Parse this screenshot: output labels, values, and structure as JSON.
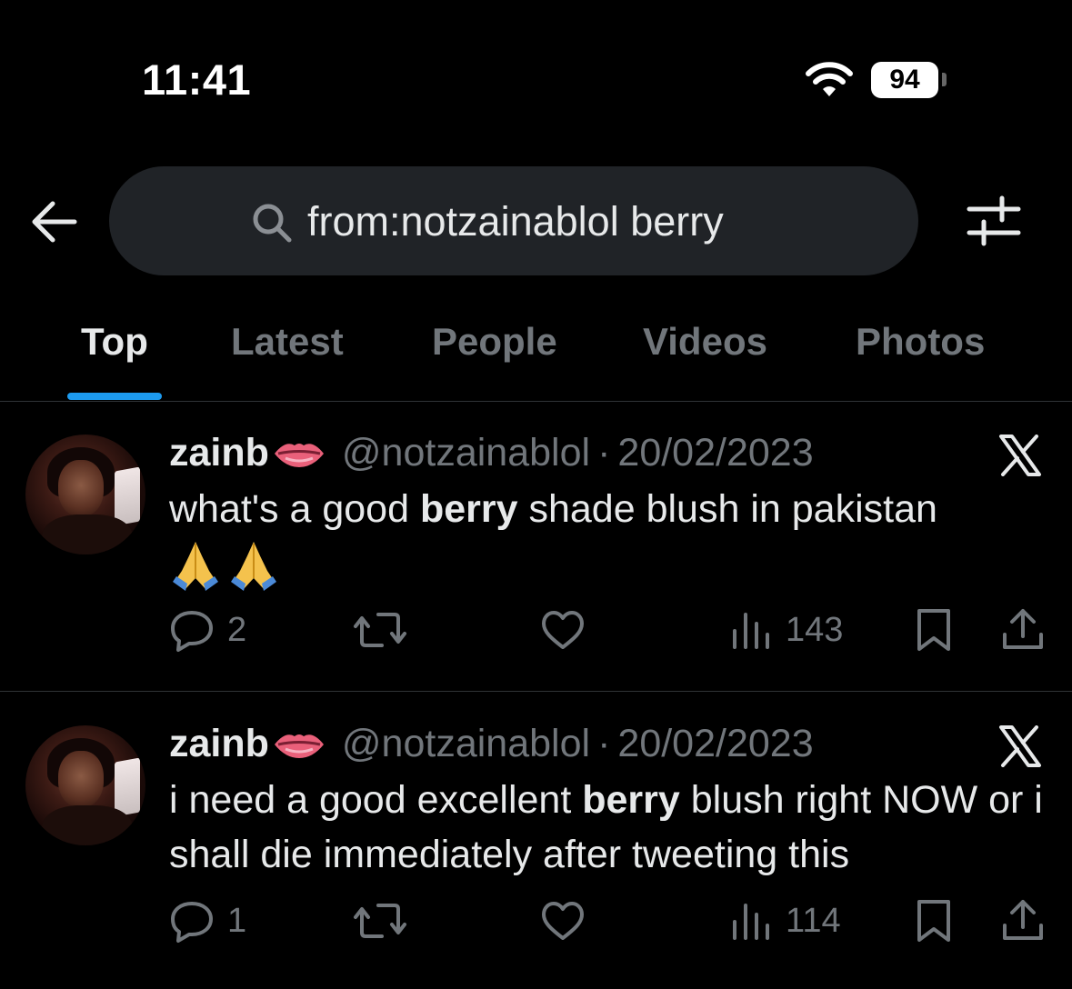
{
  "status_bar": {
    "time": "11:41",
    "battery": "94",
    "icons": [
      "wifi-icon",
      "battery-icon"
    ]
  },
  "search": {
    "query": "from:notzainablol berry",
    "icons": [
      "back-arrow-icon",
      "search-icon",
      "filter-sliders-icon"
    ]
  },
  "tabs": [
    {
      "label": "Top",
      "active": true
    },
    {
      "label": "Latest",
      "active": false
    },
    {
      "label": "People",
      "active": false
    },
    {
      "label": "Videos",
      "active": false
    },
    {
      "label": "Photos",
      "active": false
    }
  ],
  "colors": {
    "accent": "#1d9bf0",
    "background": "#000000",
    "secondary_text": "#71767b",
    "search_bg": "#202327"
  },
  "tweets": [
    {
      "display_name": "zainb",
      "name_emoji": "lips-emoji",
      "handle": "@notzainablol",
      "separator": "·",
      "date": "20/02/2023",
      "text_before": "what's a good ",
      "text_bold": "berry",
      "text_after": " shade blush in pakistan",
      "trailing_emojis": [
        "folded-hands-emoji",
        "folded-hands-emoji"
      ],
      "replies": "2",
      "views": "143",
      "icons": [
        "x-logo-icon",
        "reply-icon",
        "retweet-icon",
        "like-icon",
        "views-icon",
        "bookmark-icon",
        "share-icon"
      ]
    },
    {
      "display_name": "zainb",
      "name_emoji": "lips-emoji",
      "handle": "@notzainablol",
      "separator": "·",
      "date": "20/02/2023",
      "text_before": "i need a good excellent ",
      "text_bold": "berry",
      "text_after": " blush right NOW or i shall die immediately after tweeting this",
      "trailing_emojis": [],
      "replies": "1",
      "views": "114",
      "icons": [
        "x-logo-icon",
        "reply-icon",
        "retweet-icon",
        "like-icon",
        "views-icon",
        "bookmark-icon",
        "share-icon"
      ]
    }
  ]
}
